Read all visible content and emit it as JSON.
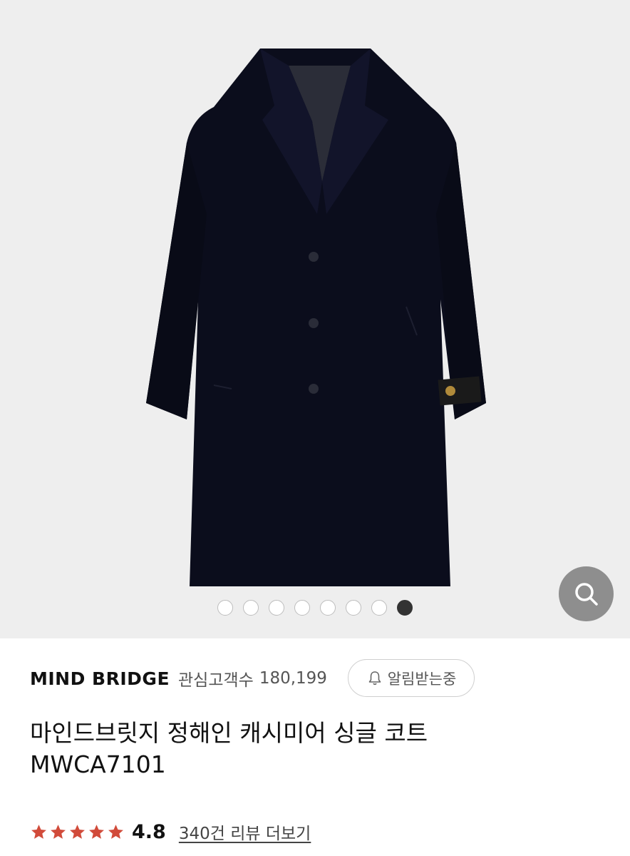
{
  "gallery": {
    "image_alt": "마인드브릿지 정해인 캐시미어 싱글 코트",
    "zoom_icon": "search-icon",
    "dots_total": 8,
    "active_dot": 8
  },
  "brand": {
    "name": "MIND BRIDGE",
    "fav_label": "관심고객수",
    "fav_count": "180,199",
    "alarm_icon": "bell-icon",
    "alarm_label": "알림받는중"
  },
  "product": {
    "title_line1": "마인드브릿지 정해인 캐시미어 싱글 코트",
    "title_line2": "MWCA7101"
  },
  "rating": {
    "stars": 5,
    "star_color": "#d14b3a",
    "value": "4.8",
    "review_link": "340건 리뷰 더보기"
  }
}
